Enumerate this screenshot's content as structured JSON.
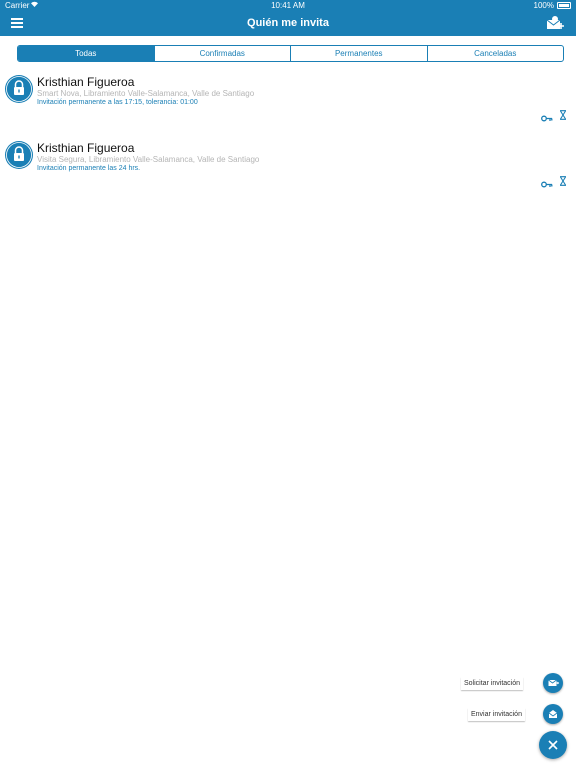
{
  "status_bar": {
    "carrier": "Carrier",
    "time": "10:41 AM",
    "battery": "100%"
  },
  "nav": {
    "title": "Quién me invita",
    "menu_icon": "hamburger-icon",
    "action_icon": "envelope-add-icon"
  },
  "tabs": [
    {
      "label": "Todas",
      "active": true
    },
    {
      "label": "Confirmadas",
      "active": false
    },
    {
      "label": "Permanentes",
      "active": false
    },
    {
      "label": "Canceladas",
      "active": false
    }
  ],
  "invitations": [
    {
      "name": "Kristhian Figueroa",
      "address": "Smart Nova, Libramiento Valle-Salamanca, Valle de Santiago",
      "detail": "Invitación permanente a las 17:15, tolerancia: 01:00"
    },
    {
      "name": "Kristhian Figueroa",
      "address": "Visita Segura, Libramiento Valle-Salamanca, Valle de Santiago",
      "detail": "Invitación permanente las 24 hrs."
    }
  ],
  "fab_menu": {
    "request_label": "Solicitar invitación",
    "send_label": "Enviar invitación",
    "close_icon": "close-icon"
  },
  "colors": {
    "primary": "#1a7fb5",
    "address_gray": "#b5b5b5"
  }
}
